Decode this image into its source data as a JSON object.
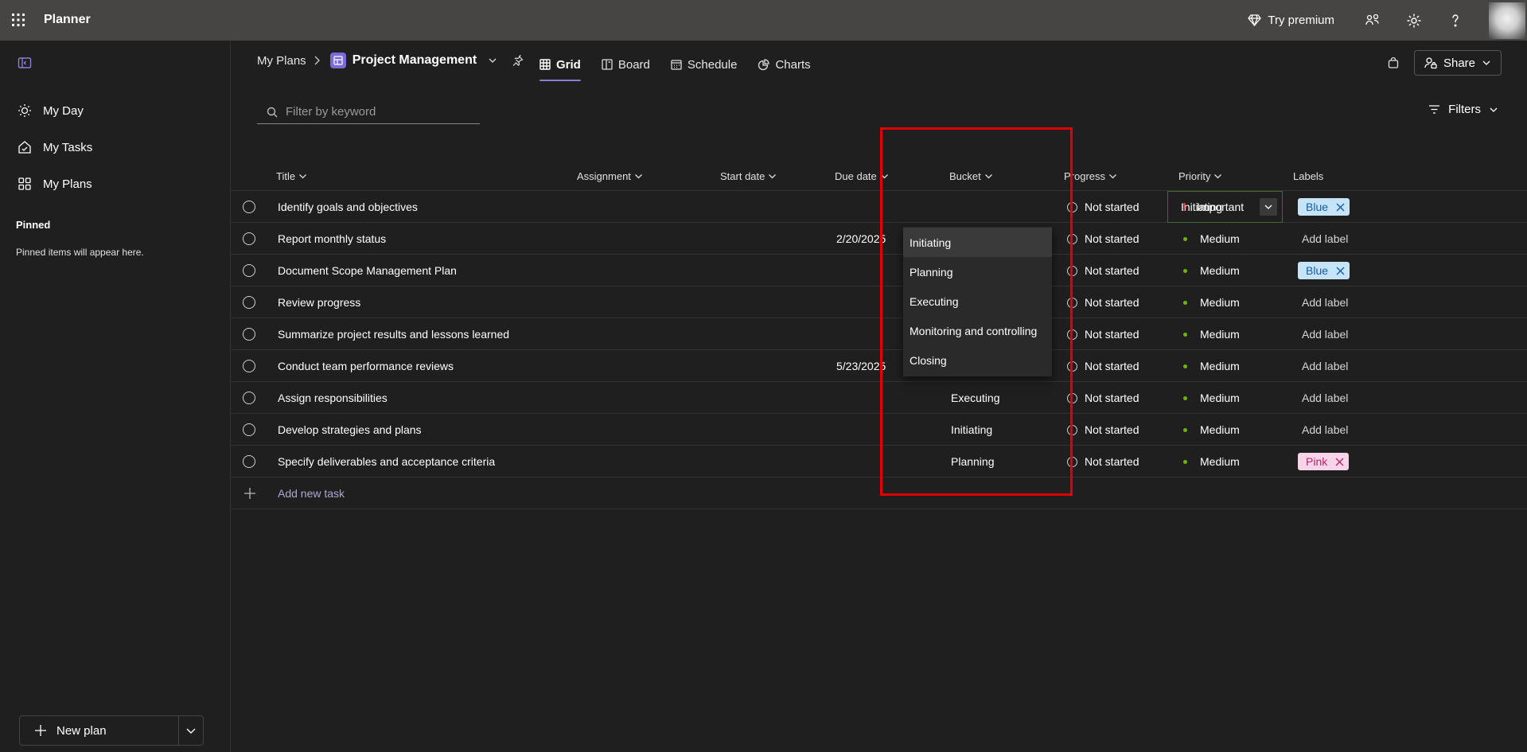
{
  "app": {
    "title": "Planner"
  },
  "topbar": {
    "try_premium": "Try premium",
    "icons": [
      "diamond-icon",
      "share-people-icon",
      "gear-icon",
      "help-icon"
    ]
  },
  "sidebar": {
    "items": [
      {
        "label": "My Day",
        "icon": "sun-icon"
      },
      {
        "label": "My Tasks",
        "icon": "house-check-icon"
      },
      {
        "label": "My Plans",
        "icon": "grid-icon"
      }
    ],
    "pinned_title": "Pinned",
    "pinned_empty": "Pinned items will appear here.",
    "new_plan": "New plan"
  },
  "breadcrumb": {
    "root": "My Plans",
    "plan": "Project Management"
  },
  "tabs": [
    {
      "label": "Grid",
      "active": true
    },
    {
      "label": "Board",
      "active": false
    },
    {
      "label": "Schedule",
      "active": false
    },
    {
      "label": "Charts",
      "active": false
    }
  ],
  "header": {
    "share": "Share"
  },
  "filter": {
    "placeholder": "Filter by keyword",
    "filters_label": "Filters"
  },
  "columns": {
    "title": "Title",
    "assignment": "Assignment",
    "start": "Start date",
    "due": "Due date",
    "bucket": "Bucket",
    "progress": "Progress",
    "priority": "Priority",
    "labels": "Labels"
  },
  "rows": [
    {
      "title": "Identify goals and objectives",
      "due": "",
      "bucket": "Initiating",
      "progress": "Not started",
      "priority": "Important",
      "label": "Blue"
    },
    {
      "title": "Report monthly status",
      "due": "2/20/2025",
      "bucket": "",
      "progress": "Not started",
      "priority": "Medium",
      "label": "Add label"
    },
    {
      "title": "Document Scope Management Plan",
      "due": "",
      "bucket": "",
      "progress": "Not started",
      "priority": "Medium",
      "label": "Blue"
    },
    {
      "title": "Review progress",
      "due": "",
      "bucket": "",
      "progress": "Not started",
      "priority": "Medium",
      "label": "Add label"
    },
    {
      "title": "Summarize project results and lessons learned",
      "due": "",
      "bucket": "",
      "progress": "Not started",
      "priority": "Medium",
      "label": "Add label"
    },
    {
      "title": "Conduct team performance reviews",
      "due": "5/23/2025",
      "bucket": "",
      "progress": "Not started",
      "priority": "Medium",
      "label": "Add label"
    },
    {
      "title": "Assign responsibilities",
      "due": "",
      "bucket": "Executing",
      "progress": "Not started",
      "priority": "Medium",
      "label": "Add label"
    },
    {
      "title": "Develop strategies and plans",
      "due": "",
      "bucket": "Initiating",
      "progress": "Not started",
      "priority": "Medium",
      "label": "Add label"
    },
    {
      "title": "Specify deliverables and acceptance criteria",
      "due": "",
      "bucket": "Planning",
      "progress": "Not started",
      "priority": "Medium",
      "label": "Pink"
    }
  ],
  "add_task": "Add new task",
  "bucket_dropdown": [
    "Initiating",
    "Planning",
    "Executing",
    "Monitoring and controlling",
    "Closing"
  ],
  "colors": {
    "accent": "#8a7fd8",
    "highlight": "#e00000",
    "medium_dot": "#6bb700",
    "important": "#e3404a"
  }
}
